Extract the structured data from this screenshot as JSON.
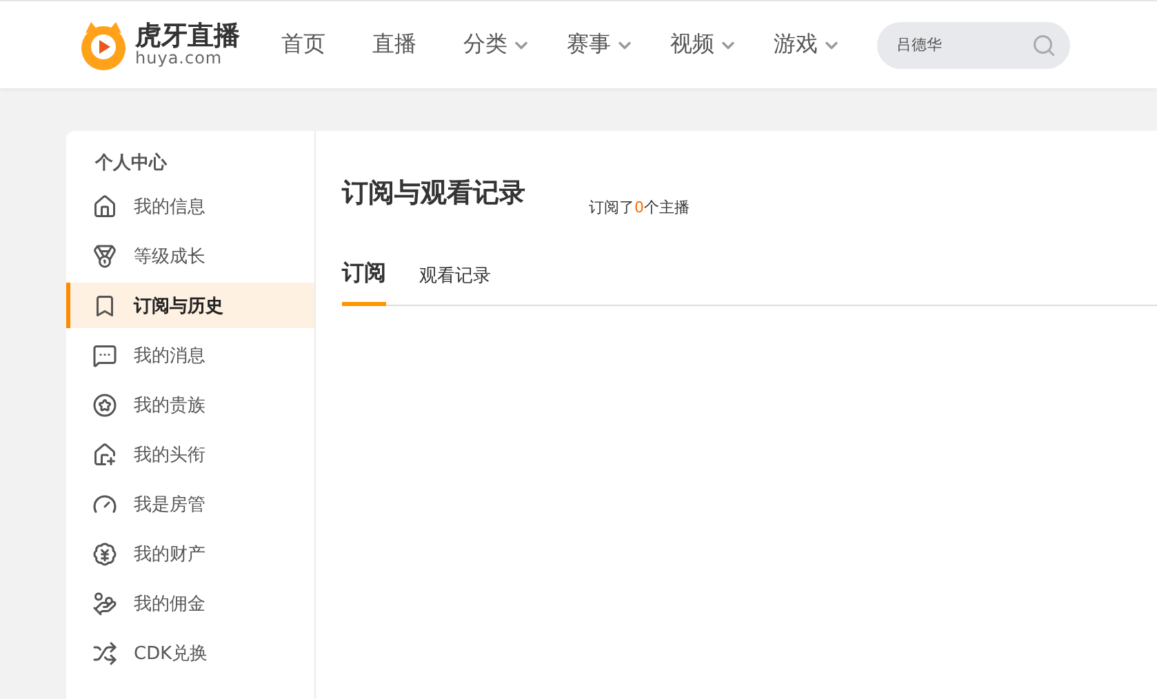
{
  "header": {
    "logo_title": "虎牙直播",
    "logo_domain": "huya.com",
    "nav": [
      {
        "label": "首页",
        "dropdown": false
      },
      {
        "label": "直播",
        "dropdown": false
      },
      {
        "label": "分类",
        "dropdown": true
      },
      {
        "label": "赛事",
        "dropdown": true
      },
      {
        "label": "视频",
        "dropdown": true
      },
      {
        "label": "游戏",
        "dropdown": true
      }
    ],
    "search": {
      "value": "吕德华"
    }
  },
  "sidebar": {
    "title": "个人中心",
    "items": [
      {
        "label": "我的信息",
        "selected": false
      },
      {
        "label": "等级成长",
        "selected": false
      },
      {
        "label": "订阅与历史",
        "selected": true
      },
      {
        "label": "我的消息",
        "selected": false
      },
      {
        "label": "我的贵族",
        "selected": false
      },
      {
        "label": "我的头衔",
        "selected": false
      },
      {
        "label": "我是房管",
        "selected": false
      },
      {
        "label": "我的财产",
        "selected": false
      },
      {
        "label": "我的佣金",
        "selected": false
      },
      {
        "label": "CDK兑换",
        "selected": false
      }
    ]
  },
  "main": {
    "title": "订阅与观看记录",
    "summary": "订阅了",
    "count": "0",
    "summary_end": "个主播",
    "tabs": [
      {
        "label": "订阅",
        "selected": true
      },
      {
        "label": "观看记录",
        "selected": false
      }
    ]
  }
}
